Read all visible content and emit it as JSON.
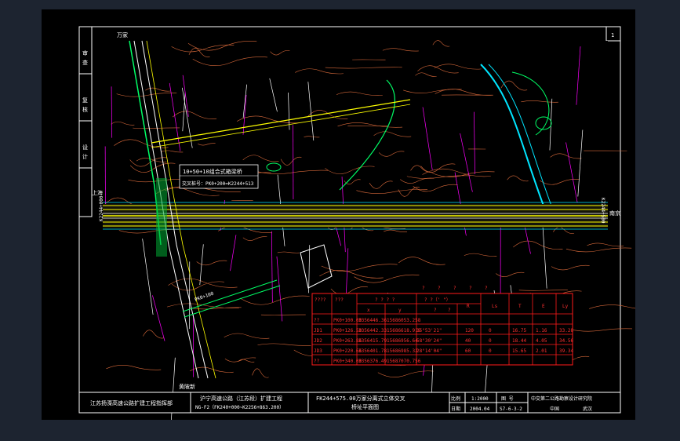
{
  "drawing": {
    "sheet_number": "1",
    "top_place": "万家",
    "bottom_place": "黄陂新",
    "left_route": {
      "name": "上海",
      "station": "K2244+000"
    },
    "right_route": {
      "name": "南京",
      "station": "K2244+500"
    },
    "annotation_title": "10+50+10组合式箱梁桥",
    "annotation_sub": "交叉桩号：PK0+200=K2244+513",
    "ramp_label": "PK0+100",
    "side_labels": [
      "审",
      "查",
      "复",
      "核",
      "设",
      "计"
    ]
  },
  "table": {
    "question_marks": [
      "?",
      "?",
      "?",
      "?",
      "?"
    ],
    "header_top": [
      "????",
      "???",
      "? ? ? ?",
      "? ?（' \"）",
      "R",
      "Ls",
      "T",
      "E",
      "Ly"
    ],
    "header_xy": [
      "x",
      "y",
      "?",
      "?"
    ],
    "rows": [
      [
        "??",
        "PK0+100.00",
        "3356446.36",
        "15686053.258",
        "",
        "",
        "",
        "",
        "",
        ""
      ],
      [
        "JD1",
        "PK0+126.50",
        "3356442.33",
        "15686618.919",
        "15°53'21\"",
        "120",
        "0",
        "16.75",
        "1.16",
        "33.28"
      ],
      [
        "JD2",
        "PK0+263.86",
        "3356415.79",
        "15686956.64",
        "58°30'24\"",
        "40",
        "0",
        "18.44",
        "4.05",
        "34.56"
      ],
      [
        "JD3",
        "PK0+220.66",
        "3356401.78",
        "15686985.32",
        "28°14'04\"",
        "60",
        "0",
        "15.65",
        "2.01",
        "39.34"
      ],
      [
        "??",
        "PK0+340.00",
        "3356376.49",
        "15687070.756",
        "",
        "",
        "",
        "",
        "",
        ""
      ]
    ]
  },
  "title_block": {
    "left_org": "江苏扬溧高速公路扩建工程指挥部",
    "project_line1": "沪宁高速公路（江苏段）扩建工程",
    "project_line2": "NG-F2（FK240+000~K2256+863.200）",
    "drawing_title_1": "FK244+575.00万家分离式立体交叉",
    "drawing_title_2": "桥址平面图",
    "scale_label": "比例",
    "scale_value": "1:2000",
    "date_label": "日期",
    "date_value": "2004.04",
    "figno_label": "图 号",
    "figno_value": "S7-6-3-2",
    "designer": "中交第二公路勘察设计研究院",
    "city_a": "中国",
    "city_b": "武汉"
  },
  "colors": {
    "background": "#1d2430",
    "canvas": "#000000",
    "contour": "#d8693a",
    "parcel": "#ff00ff",
    "road": "#ffff00",
    "water": "#00ff66",
    "cyan": "#00e5ff",
    "table_red": "#ff1a1a"
  }
}
